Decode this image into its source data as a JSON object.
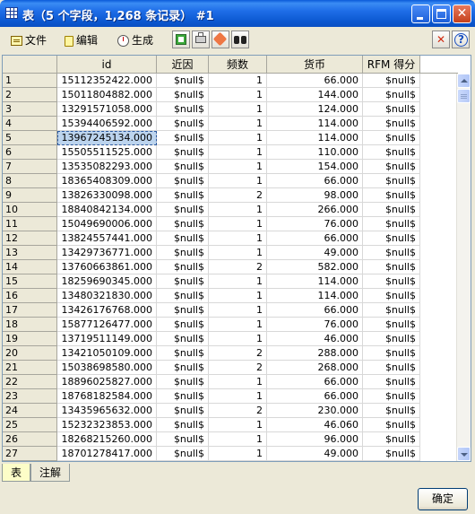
{
  "window": {
    "title": "表（5 个字段，1,268 条记录） #1"
  },
  "toolbar": {
    "file_label": "文件",
    "edit_label": "编辑",
    "generate_label": "生成"
  },
  "table": {
    "columns": [
      "id",
      "近因",
      "频数",
      "货币",
      "RFM 得分"
    ],
    "selected_row": 5,
    "rows": [
      {
        "n": "1",
        "id": "15112352422.000",
        "r": "$null$",
        "f": "1",
        "m": "66.000",
        "s": "$null$"
      },
      {
        "n": "2",
        "id": "15011804882.000",
        "r": "$null$",
        "f": "1",
        "m": "144.000",
        "s": "$null$"
      },
      {
        "n": "3",
        "id": "13291571058.000",
        "r": "$null$",
        "f": "1",
        "m": "124.000",
        "s": "$null$"
      },
      {
        "n": "4",
        "id": "15394406592.000",
        "r": "$null$",
        "f": "1",
        "m": "114.000",
        "s": "$null$"
      },
      {
        "n": "5",
        "id": "13967245134.000",
        "r": "$null$",
        "f": "1",
        "m": "114.000",
        "s": "$null$"
      },
      {
        "n": "6",
        "id": "15505511525.000",
        "r": "$null$",
        "f": "1",
        "m": "110.000",
        "s": "$null$"
      },
      {
        "n": "7",
        "id": "13535082293.000",
        "r": "$null$",
        "f": "1",
        "m": "154.000",
        "s": "$null$"
      },
      {
        "n": "8",
        "id": "18365408309.000",
        "r": "$null$",
        "f": "1",
        "m": "66.000",
        "s": "$null$"
      },
      {
        "n": "9",
        "id": "13826330098.000",
        "r": "$null$",
        "f": "2",
        "m": "98.000",
        "s": "$null$"
      },
      {
        "n": "10",
        "id": "18840842134.000",
        "r": "$null$",
        "f": "1",
        "m": "266.000",
        "s": "$null$"
      },
      {
        "n": "11",
        "id": "15049690006.000",
        "r": "$null$",
        "f": "1",
        "m": "76.000",
        "s": "$null$"
      },
      {
        "n": "12",
        "id": "13824557441.000",
        "r": "$null$",
        "f": "1",
        "m": "66.000",
        "s": "$null$"
      },
      {
        "n": "13",
        "id": "13429736771.000",
        "r": "$null$",
        "f": "1",
        "m": "49.000",
        "s": "$null$"
      },
      {
        "n": "14",
        "id": "13760663861.000",
        "r": "$null$",
        "f": "2",
        "m": "582.000",
        "s": "$null$"
      },
      {
        "n": "15",
        "id": "18259690345.000",
        "r": "$null$",
        "f": "1",
        "m": "114.000",
        "s": "$null$"
      },
      {
        "n": "16",
        "id": "13480321830.000",
        "r": "$null$",
        "f": "1",
        "m": "114.000",
        "s": "$null$"
      },
      {
        "n": "17",
        "id": "13426176768.000",
        "r": "$null$",
        "f": "1",
        "m": "66.000",
        "s": "$null$"
      },
      {
        "n": "18",
        "id": "15877126477.000",
        "r": "$null$",
        "f": "1",
        "m": "76.000",
        "s": "$null$"
      },
      {
        "n": "19",
        "id": "13719511149.000",
        "r": "$null$",
        "f": "1",
        "m": "46.000",
        "s": "$null$"
      },
      {
        "n": "20",
        "id": "13421050109.000",
        "r": "$null$",
        "f": "2",
        "m": "288.000",
        "s": "$null$"
      },
      {
        "n": "21",
        "id": "15038698580.000",
        "r": "$null$",
        "f": "2",
        "m": "268.000",
        "s": "$null$"
      },
      {
        "n": "22",
        "id": "18896025827.000",
        "r": "$null$",
        "f": "1",
        "m": "66.000",
        "s": "$null$"
      },
      {
        "n": "23",
        "id": "18768182584.000",
        "r": "$null$",
        "f": "1",
        "m": "66.000",
        "s": "$null$"
      },
      {
        "n": "24",
        "id": "13435965632.000",
        "r": "$null$",
        "f": "2",
        "m": "230.000",
        "s": "$null$"
      },
      {
        "n": "25",
        "id": "15232323853.000",
        "r": "$null$",
        "f": "1",
        "m": "46.060",
        "s": "$null$"
      },
      {
        "n": "26",
        "id": "18268215260.000",
        "r": "$null$",
        "f": "1",
        "m": "96.000",
        "s": "$null$"
      },
      {
        "n": "27",
        "id": "18701278417.000",
        "r": "$null$",
        "f": "1",
        "m": "49.000",
        "s": "$null$"
      }
    ]
  },
  "tabs": [
    "表",
    "注解"
  ],
  "footer": {
    "ok_label": "确定"
  }
}
